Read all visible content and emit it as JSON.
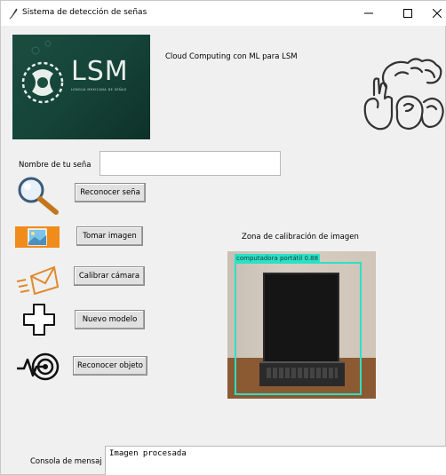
{
  "window": {
    "title": "Sistema de detección de señas"
  },
  "header": {
    "logo_text": "LSM",
    "logo_subtext": "LENGUA MEXICANA DE SEÑAS",
    "subtitle": "Cloud Computing con ML para LSM"
  },
  "form": {
    "name_label": "Nombre de tu seña",
    "name_value": "",
    "name_placeholder": ""
  },
  "actions": {
    "recognize_sign": "Reconocer seña",
    "take_image": "Tomar imagen",
    "calibrate_camera": "Calibrar cámara",
    "new_model": "Nuevo modelo",
    "recognize_object": "Reconocer objeto"
  },
  "calibration": {
    "title": "Zona de calibración de imagen",
    "detection_label": "computadora portátil 0.88",
    "box_color": "#2de0c5"
  },
  "console": {
    "label": "Consola de mensaj",
    "message": "Imagen procesada"
  }
}
